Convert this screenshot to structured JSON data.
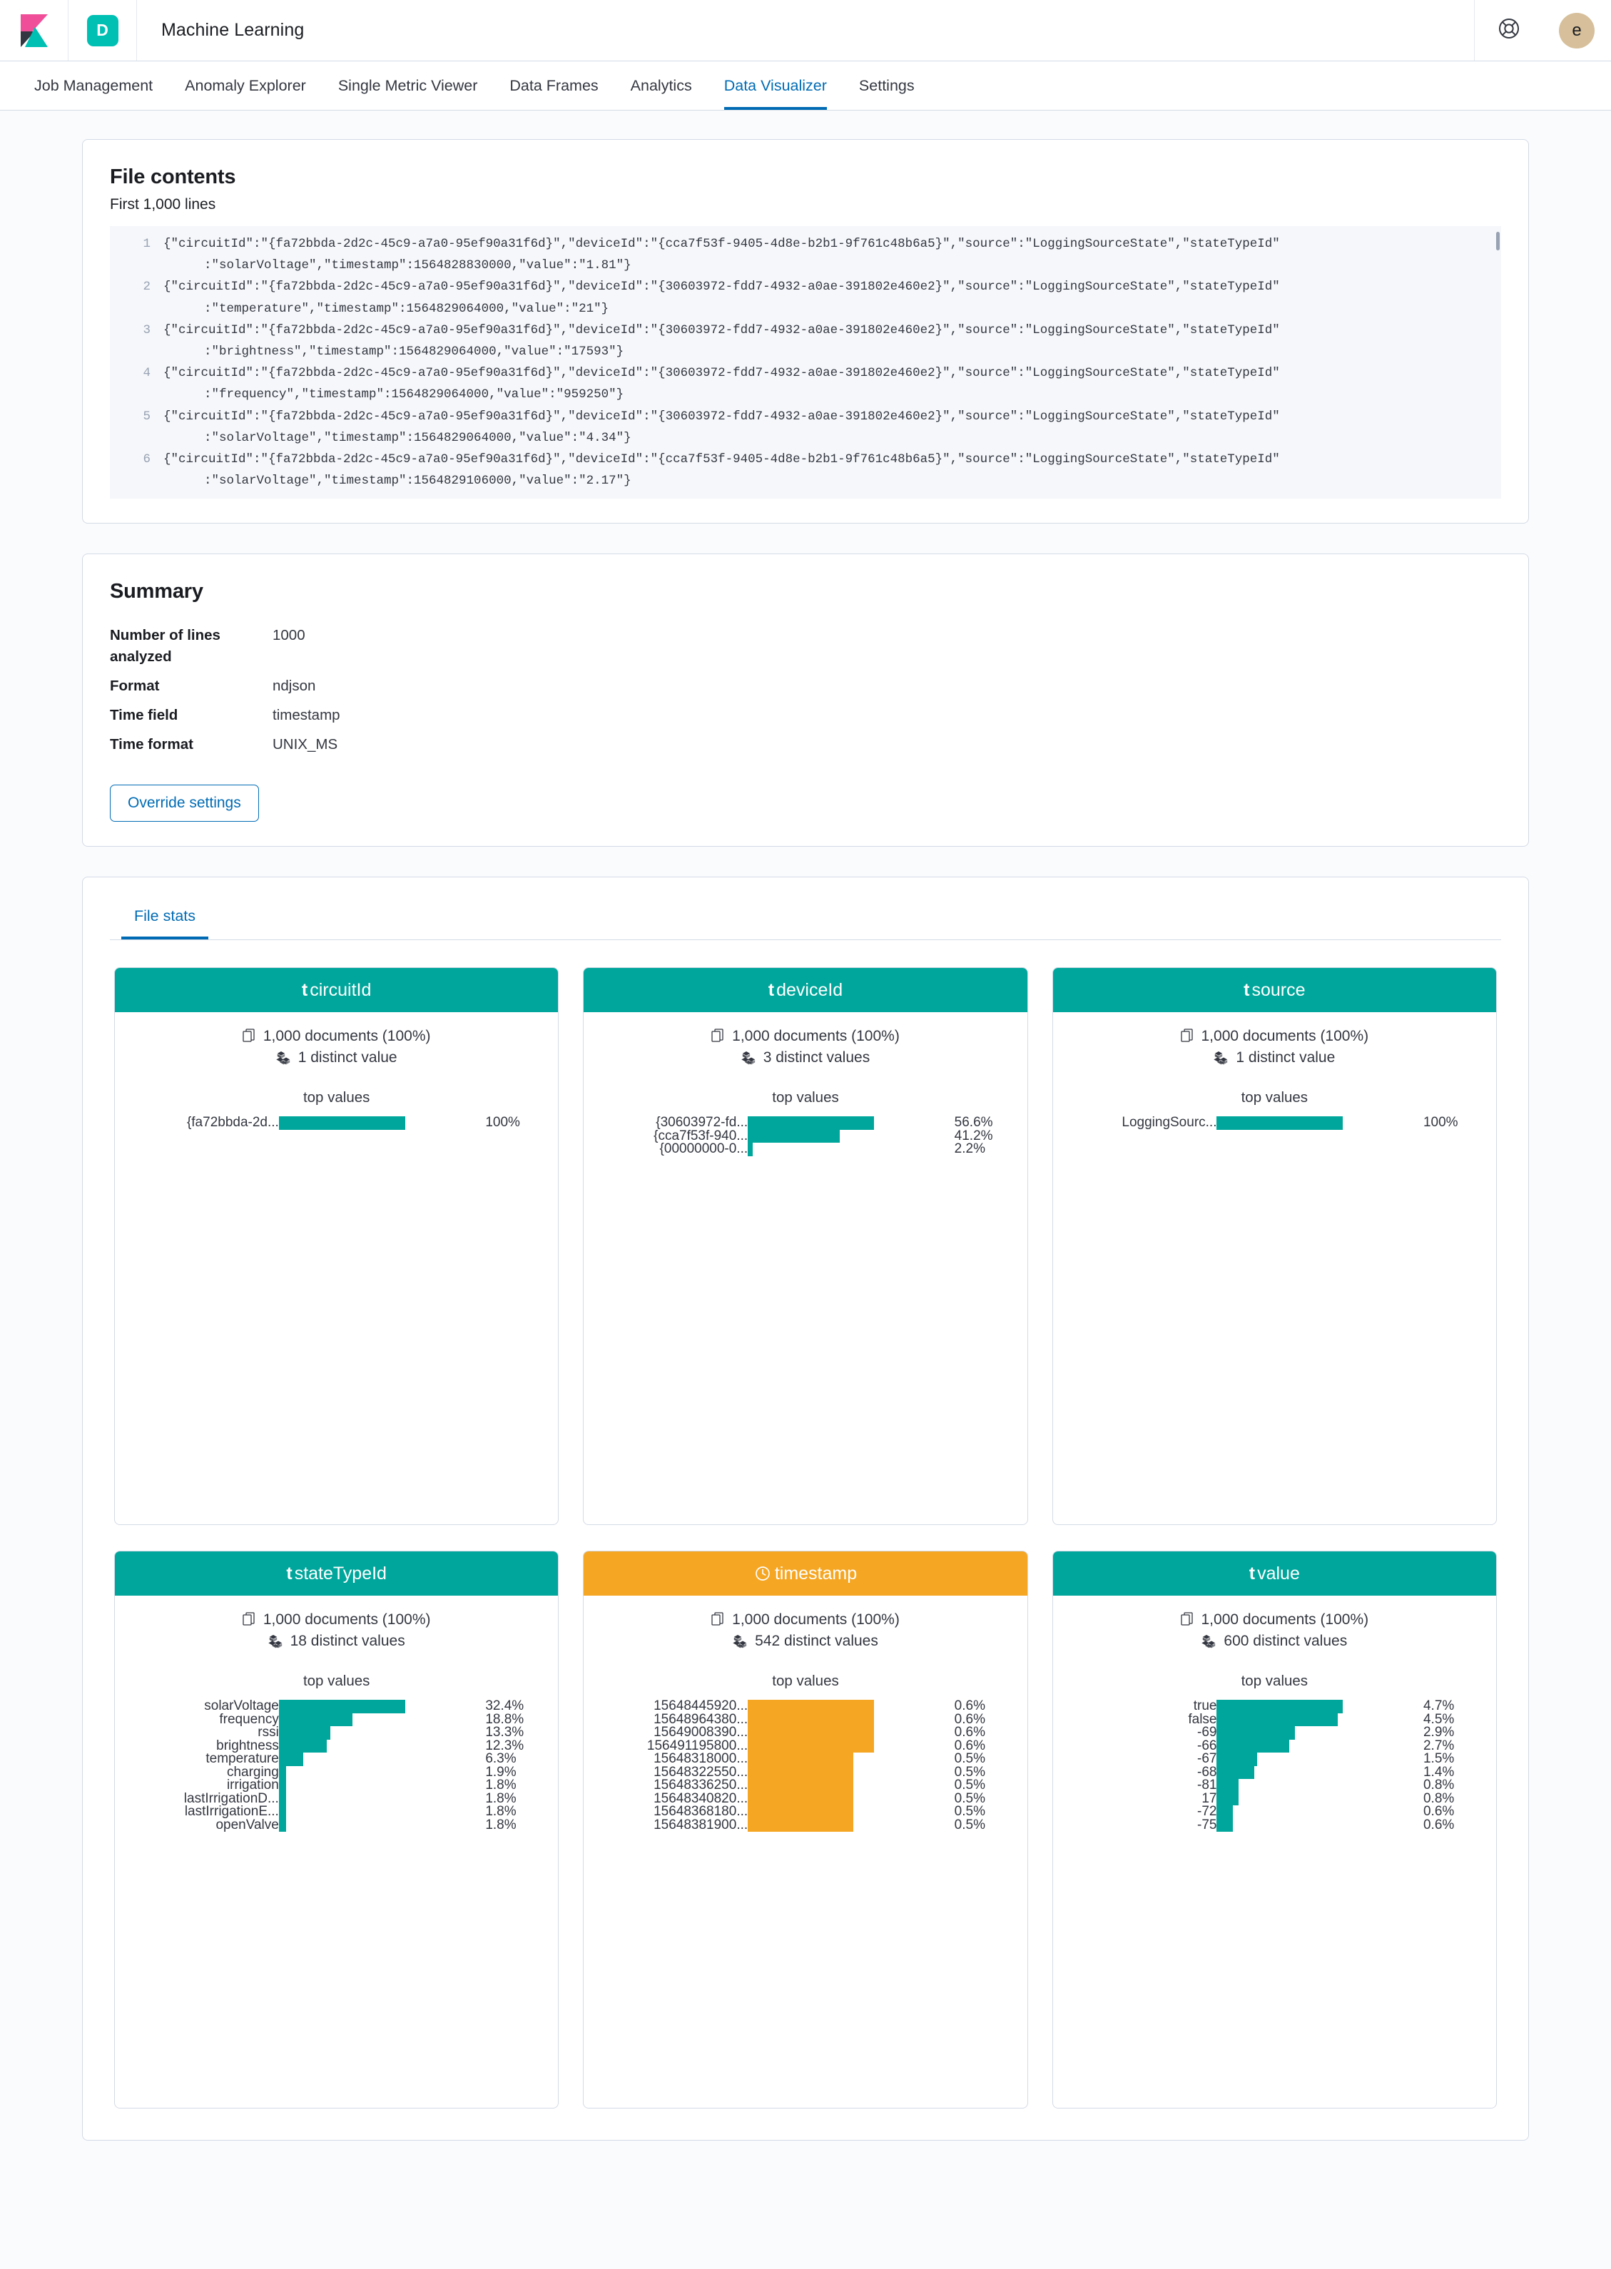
{
  "chrome": {
    "logo_name": "kibana-logo",
    "space_badge": "D",
    "app_title": "Machine Learning",
    "help_icon": "lifebuoy-icon",
    "avatar_initial": "e"
  },
  "nav": {
    "tabs": [
      {
        "label": "Job Management",
        "active": false
      },
      {
        "label": "Anomaly Explorer",
        "active": false
      },
      {
        "label": "Single Metric Viewer",
        "active": false
      },
      {
        "label": "Data Frames",
        "active": false
      },
      {
        "label": "Analytics",
        "active": false
      },
      {
        "label": "Data Visualizer",
        "active": true
      },
      {
        "label": "Settings",
        "active": false
      }
    ]
  },
  "file_contents": {
    "title": "File contents",
    "subtitle": "First 1,000 lines",
    "lines": [
      {
        "number": "1",
        "part1": "{\"circuitId\":\"{fa72bbda-2d2c-45c9-a7a0-95ef90a31f6d}\",\"deviceId\":\"{cca7f53f-9405-4d8e-b2b1-9f761c48b6a5}\",\"source\":\"LoggingSourceState\",\"stateTypeId\"",
        "part2": ":\"solarVoltage\",\"timestamp\":1564828830000,\"value\":\"1.81\"}"
      },
      {
        "number": "2",
        "part1": "{\"circuitId\":\"{fa72bbda-2d2c-45c9-a7a0-95ef90a31f6d}\",\"deviceId\":\"{30603972-fdd7-4932-a0ae-391802e460e2}\",\"source\":\"LoggingSourceState\",\"stateTypeId\"",
        "part2": ":\"temperature\",\"timestamp\":1564829064000,\"value\":\"21\"}"
      },
      {
        "number": "3",
        "part1": "{\"circuitId\":\"{fa72bbda-2d2c-45c9-a7a0-95ef90a31f6d}\",\"deviceId\":\"{30603972-fdd7-4932-a0ae-391802e460e2}\",\"source\":\"LoggingSourceState\",\"stateTypeId\"",
        "part2": ":\"brightness\",\"timestamp\":1564829064000,\"value\":\"17593\"}"
      },
      {
        "number": "4",
        "part1": "{\"circuitId\":\"{fa72bbda-2d2c-45c9-a7a0-95ef90a31f6d}\",\"deviceId\":\"{30603972-fdd7-4932-a0ae-391802e460e2}\",\"source\":\"LoggingSourceState\",\"stateTypeId\"",
        "part2": ":\"frequency\",\"timestamp\":1564829064000,\"value\":\"959250\"}"
      },
      {
        "number": "5",
        "part1": "{\"circuitId\":\"{fa72bbda-2d2c-45c9-a7a0-95ef90a31f6d}\",\"deviceId\":\"{30603972-fdd7-4932-a0ae-391802e460e2}\",\"source\":\"LoggingSourceState\",\"stateTypeId\"",
        "part2": ":\"solarVoltage\",\"timestamp\":1564829064000,\"value\":\"4.34\"}"
      },
      {
        "number": "6",
        "part1": "{\"circuitId\":\"{fa72bbda-2d2c-45c9-a7a0-95ef90a31f6d}\",\"deviceId\":\"{cca7f53f-9405-4d8e-b2b1-9f761c48b6a5}\",\"source\":\"LoggingSourceState\",\"stateTypeId\"",
        "part2": ":\"solarVoltage\",\"timestamp\":1564829106000,\"value\":\"2.17\"}"
      }
    ]
  },
  "summary": {
    "title": "Summary",
    "rows": [
      {
        "key": "Number of lines analyzed",
        "value": "1000"
      },
      {
        "key": "Format",
        "value": "ndjson"
      },
      {
        "key": "Time field",
        "value": "timestamp"
      },
      {
        "key": "Time format",
        "value": "UNIX_MS"
      }
    ],
    "override_button": "Override settings"
  },
  "file_stats": {
    "tab_label": "File stats",
    "top_values_label": "top values",
    "colors": {
      "teal": "#00a69b",
      "orange": "#f5a623"
    },
    "cards": [
      {
        "name": "circuitId",
        "type_icon": "t",
        "header_color": "teal",
        "documents": "1,000 documents (100%)",
        "distinct": "1 distinct value",
        "top_values": [
          {
            "label": "{fa72bbda-2d...",
            "pct": "100%",
            "bar": 100
          }
        ]
      },
      {
        "name": "deviceId",
        "type_icon": "t",
        "header_color": "teal",
        "documents": "1,000 documents (100%)",
        "distinct": "3 distinct values",
        "top_values": [
          {
            "label": "{30603972-fd...",
            "pct": "56.6%",
            "bar": 56.6
          },
          {
            "label": "{cca7f53f-940...",
            "pct": "41.2%",
            "bar": 41.2
          },
          {
            "label": "{00000000-0...",
            "pct": "2.2%",
            "bar": 2.2
          }
        ]
      },
      {
        "name": "source",
        "type_icon": "t",
        "header_color": "teal",
        "documents": "1,000 documents (100%)",
        "distinct": "1 distinct value",
        "top_values": [
          {
            "label": "LoggingSourc...",
            "pct": "100%",
            "bar": 100
          }
        ]
      },
      {
        "name": "stateTypeId",
        "type_icon": "t",
        "header_color": "teal",
        "documents": "1,000 documents (100%)",
        "distinct": "18 distinct values",
        "top_values": [
          {
            "label": "solarVoltage",
            "pct": "32.4%",
            "bar": 32.4
          },
          {
            "label": "frequency",
            "pct": "18.8%",
            "bar": 18.8
          },
          {
            "label": "rssi",
            "pct": "13.3%",
            "bar": 13.3
          },
          {
            "label": "brightness",
            "pct": "12.3%",
            "bar": 12.3
          },
          {
            "label": "temperature",
            "pct": "6.3%",
            "bar": 6.3
          },
          {
            "label": "charging",
            "pct": "1.9%",
            "bar": 1.9
          },
          {
            "label": "irrigation",
            "pct": "1.8%",
            "bar": 1.8
          },
          {
            "label": "lastIrrigationD...",
            "pct": "1.8%",
            "bar": 1.8
          },
          {
            "label": "lastIrrigationE...",
            "pct": "1.8%",
            "bar": 1.8
          },
          {
            "label": "openValve",
            "pct": "1.8%",
            "bar": 1.8
          }
        ]
      },
      {
        "name": "timestamp",
        "type_icon": "clock",
        "header_color": "orange",
        "documents": "1,000 documents (100%)",
        "distinct": "542 distinct values",
        "top_values": [
          {
            "label": "15648445920...",
            "pct": "0.6%",
            "bar": 0.6
          },
          {
            "label": "15648964380...",
            "pct": "0.6%",
            "bar": 0.6
          },
          {
            "label": "15649008390...",
            "pct": "0.6%",
            "bar": 0.6
          },
          {
            "label": "156491195800...",
            "pct": "0.6%",
            "bar": 0.6
          },
          {
            "label": "15648318000...",
            "pct": "0.5%",
            "bar": 0.5
          },
          {
            "label": "15648322550...",
            "pct": "0.5%",
            "bar": 0.5
          },
          {
            "label": "15648336250...",
            "pct": "0.5%",
            "bar": 0.5
          },
          {
            "label": "15648340820...",
            "pct": "0.5%",
            "bar": 0.5
          },
          {
            "label": "15648368180...",
            "pct": "0.5%",
            "bar": 0.5
          },
          {
            "label": "15648381900...",
            "pct": "0.5%",
            "bar": 0.5
          }
        ]
      },
      {
        "name": "value",
        "type_icon": "t",
        "header_color": "teal",
        "documents": "1,000 documents (100%)",
        "distinct": "600 distinct values",
        "top_values": [
          {
            "label": "true",
            "pct": "4.7%",
            "bar": 4.7
          },
          {
            "label": "false",
            "pct": "4.5%",
            "bar": 4.5
          },
          {
            "label": "-69",
            "pct": "2.9%",
            "bar": 2.9
          },
          {
            "label": "-66",
            "pct": "2.7%",
            "bar": 2.7
          },
          {
            "label": "-67",
            "pct": "1.5%",
            "bar": 1.5
          },
          {
            "label": "-68",
            "pct": "1.4%",
            "bar": 1.4
          },
          {
            "label": "-81",
            "pct": "0.8%",
            "bar": 0.8
          },
          {
            "label": "17",
            "pct": "0.8%",
            "bar": 0.8
          },
          {
            "label": "-72",
            "pct": "0.6%",
            "bar": 0.6
          },
          {
            "label": "-75",
            "pct": "0.6%",
            "bar": 0.6
          }
        ]
      }
    ]
  }
}
